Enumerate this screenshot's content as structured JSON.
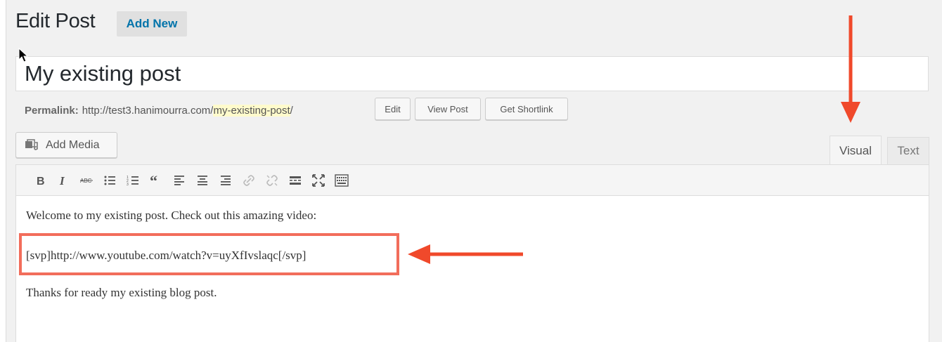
{
  "header": {
    "title": "Edit Post",
    "add_new_label": "Add New"
  },
  "post": {
    "title": "My existing post"
  },
  "permalink": {
    "label": "Permalink:",
    "base": "http://test3.hanimourra.com/",
    "slug": "my-existing-post",
    "trailing": "/",
    "edit_label": "Edit",
    "view_label": "View Post",
    "shortlink_label": "Get Shortlink"
  },
  "editor": {
    "add_media_label": "Add Media",
    "tabs": [
      {
        "label": "Visual",
        "active": true
      },
      {
        "label": "Text",
        "active": false
      }
    ],
    "toolbar_icons": [
      "bold-icon",
      "italic-icon",
      "strikethrough-icon",
      "bullet-list-icon",
      "numbered-list-icon",
      "blockquote-icon",
      "align-left-icon",
      "align-center-icon",
      "align-right-icon",
      "insert-link-icon",
      "remove-link-icon",
      "read-more-icon",
      "fullscreen-icon",
      "toolbar-toggle-icon"
    ],
    "paragraphs": [
      "Welcome to my existing post.  Check out this amazing video:",
      "[svp]http://www.youtube.com/watch?v=uyXfIvslaqc[/svp]",
      "Thanks for ready my existing blog post."
    ]
  },
  "annotations": {
    "arrow_color": "#f0492b",
    "box_color": "#f26d5b"
  }
}
